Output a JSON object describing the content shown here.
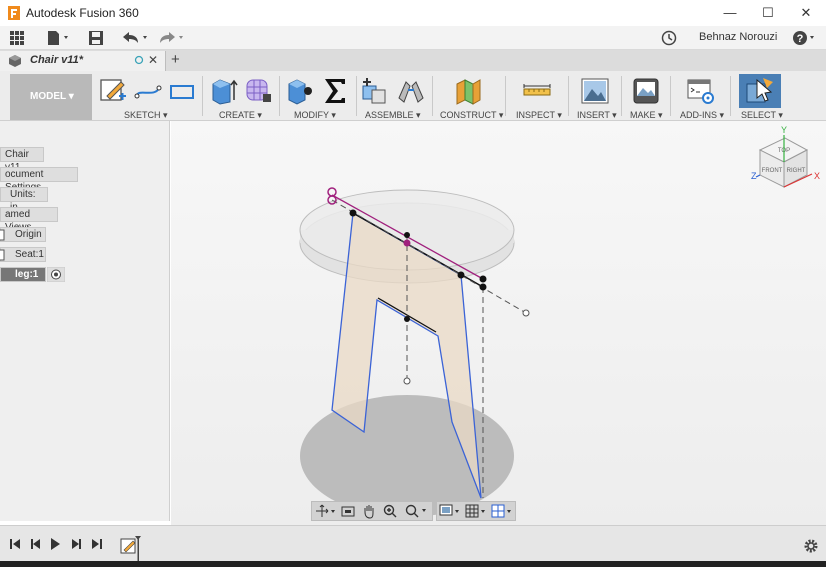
{
  "window": {
    "title": "Autodesk Fusion 360",
    "minimize_glyph": "—",
    "maximize_glyph": "☐",
    "close_glyph": "✕"
  },
  "quick_access": {
    "user_name": "Behnaz Norouzi",
    "help_glyph": "?"
  },
  "document_tab": {
    "label": "Chair v11*",
    "new_tab_glyph": "+",
    "close_glyph": "✕"
  },
  "toolbar": {
    "workspace": "MODEL ▾",
    "groups": [
      {
        "label": "SKETCH ▾"
      },
      {
        "label": "CREATE ▾"
      },
      {
        "label": "MODIFY ▾"
      },
      {
        "label": "ASSEMBLE ▾"
      },
      {
        "label": "CONSTRUCT ▾"
      },
      {
        "label": "INSPECT ▾"
      },
      {
        "label": "INSERT ▾"
      },
      {
        "label": "MAKE ▾"
      },
      {
        "label": "ADD-INS ▾"
      },
      {
        "label": "SELECT ▾"
      }
    ]
  },
  "browser": {
    "nodes": [
      {
        "label": "Chair v11"
      },
      {
        "label": "ocument Settings"
      },
      {
        "label": "Units: in"
      },
      {
        "label": "amed Views"
      },
      {
        "label": "Origin"
      },
      {
        "label": "Seat:1"
      },
      {
        "label": "leg:1"
      }
    ]
  },
  "viewcube": {
    "top": "TOP",
    "front": "FRONT",
    "right": "RIGHT",
    "axis_y": "Y",
    "axis_x": "X",
    "axis_z": "Z"
  },
  "colors": {
    "accent": "#4a7fb5",
    "sketch_profile": "#3b63d6",
    "constraint": "#a0207d",
    "leg_fill": "#ead9c6"
  }
}
